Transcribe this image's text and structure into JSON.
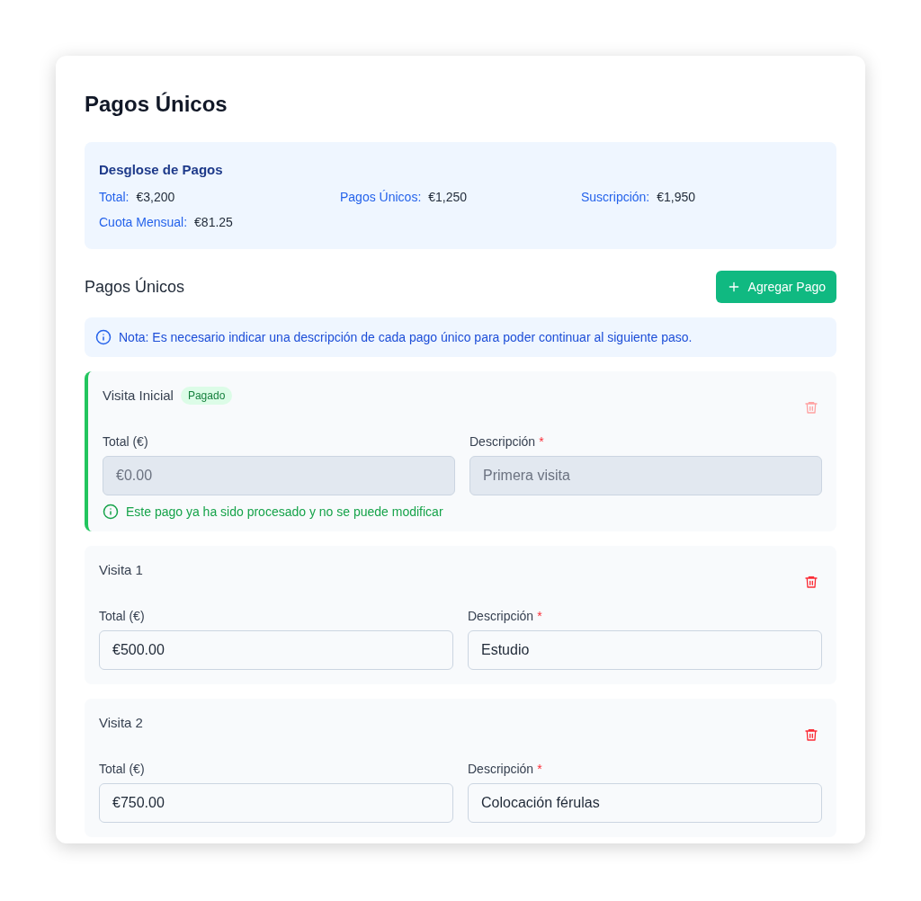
{
  "title": "Pagos Únicos",
  "summary": {
    "title": "Desglose de Pagos",
    "items": [
      {
        "label": "Total:",
        "value": "€3,200"
      },
      {
        "label": "Pagos Únicos:",
        "value": "€1,250"
      },
      {
        "label": "Suscripción:",
        "value": "€1,950"
      },
      {
        "label": "Cuota Mensual:",
        "value": "€81.25"
      }
    ]
  },
  "section": {
    "title": "Pagos Únicos",
    "add_button": "Agregar Pago"
  },
  "note": "Nota: Es necesario indicar una descripción de cada pago único para poder continuar al siguiente paso.",
  "payments": [
    {
      "name": "Visita Inicial",
      "paid": true,
      "badge": "Pagado",
      "total_label": "Total (€)",
      "total": "€0.00",
      "description_label": "Descripción",
      "required_mark": "*",
      "description": "Primera visita",
      "paid_note": "Este pago ya ha sido procesado y no se puede modificar"
    },
    {
      "name": "Visita 1",
      "paid": false,
      "total_label": "Total (€)",
      "total": "€500.00",
      "description_label": "Descripción",
      "required_mark": "*",
      "description": "Estudio"
    },
    {
      "name": "Visita 2",
      "paid": false,
      "total_label": "Total (€)",
      "total": "€750.00",
      "description_label": "Descripción",
      "required_mark": "*",
      "description": "Colocación férulas"
    }
  ]
}
